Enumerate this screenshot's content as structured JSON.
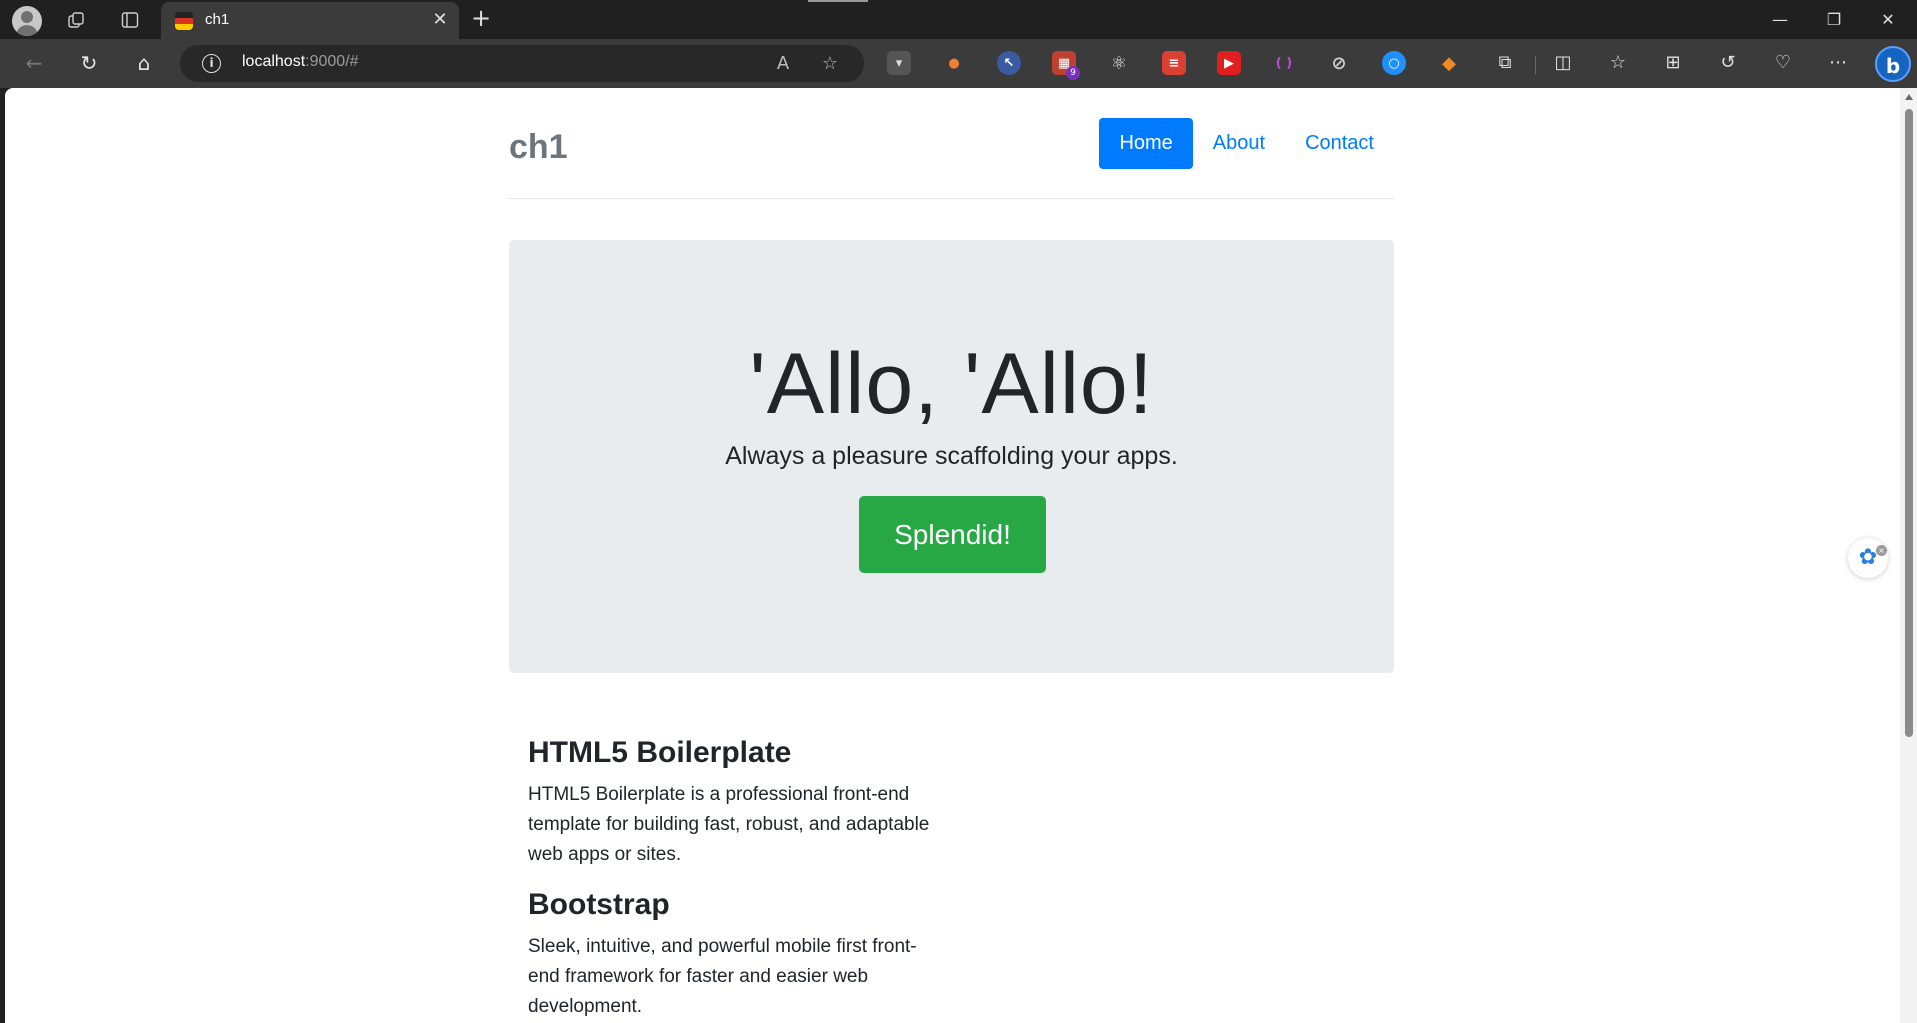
{
  "browser": {
    "tab": {
      "title": "ch1",
      "close": "✕"
    },
    "new_tab": "+",
    "window_controls": {
      "minimize": "—",
      "restore": "❐",
      "close": "✕"
    },
    "address": {
      "host": "localhost",
      "rest": ":9000/#"
    },
    "extension_badge": "9",
    "copilot_label": "b"
  },
  "page": {
    "brand": "ch1",
    "nav": [
      {
        "label": "Home",
        "active": true
      },
      {
        "label": "About",
        "active": false
      },
      {
        "label": "Contact",
        "active": false
      }
    ],
    "jumbotron": {
      "title": "'Allo, 'Allo!",
      "lead": "Always a pleasure scaffolding your apps.",
      "button": "Splendid!"
    },
    "marketing": [
      {
        "heading": "HTML5 Boilerplate",
        "text": "HTML5 Boilerplate is a professional front-end template for building fast, robust, and adaptable web apps or sites."
      },
      {
        "heading": "Bootstrap",
        "text": "Sleek, intuitive, and powerful mobile first front-end framework for faster and easier web development."
      }
    ]
  },
  "colors": {
    "primary": "#007bff",
    "success": "#28a745",
    "jumbotron_bg": "#e9ecef",
    "brand_text": "#6c757d"
  }
}
